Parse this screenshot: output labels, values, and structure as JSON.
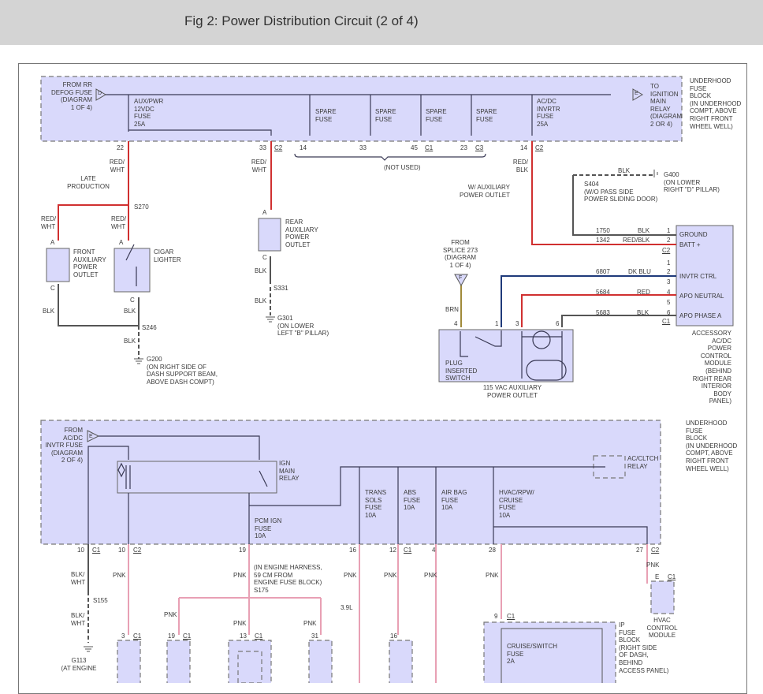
{
  "header": {
    "title": "Fig 2: Power Distribution Circuit (2 of 4)"
  },
  "colors": {
    "fuse_block_fill": "#d9d9fb",
    "wire_red": "#d03030",
    "wire_pink": "#e8a0b4",
    "wire_blue": "#1f3a7a",
    "wire_brown": "#a08a3a",
    "wire_black": "#555555"
  },
  "top_block": {
    "from_rr": "FROM RR\nDEFOG FUSE\n(DIAGRAM\n1 OF 4)",
    "conn_d": "D",
    "aux_fuse": "AUX/PWR\n12VDC\nFUSE\n25A",
    "spare_fuses": [
      "SPARE\nFUSE",
      "SPARE\nFUSE",
      "SPARE\nFUSE",
      "SPARE\nFUSE"
    ],
    "acdc_fuse": "AC/DC\nINVRTR\nFUSE\n25A",
    "conn_e": "E",
    "to_ign": "TO\nIGNITION\nMAIN\nRELAY\n(DIAGRAM\n2 OR 4)",
    "location": "UNDERHOOD\nFUSE\nBLOCK\n(IN UNDERHOOD\nCOMPT, ABOVE\nRIGHT FRONT\nWHEEL WELL)",
    "pins": [
      "22",
      "33",
      "C2",
      "14",
      "33",
      "45",
      "C1",
      "23",
      "C3",
      "14",
      "C2"
    ],
    "not_used": "(NOT USED)"
  },
  "left_circuit": {
    "wire1": "RED/\nWHT",
    "wire2": "RED/\nWHT",
    "late": "LATE\nPRODUCTION",
    "s270": "S270",
    "wire3": "RED/\nWHT",
    "wire4": "RED/\nWHT",
    "pin_a1": "A",
    "pin_a2": "A",
    "front_outlet": "FRONT\nAUXILIARY\nPOWER\nOUTLET",
    "cigar": "CIGAR\nLIGHTER",
    "pin_c1": "C",
    "pin_c2": "C",
    "blk1": "BLK",
    "blk2": "BLK",
    "s246": "S246",
    "blk3": "BLK",
    "g200": "G200\n(ON RIGHT SIDE OF\nDASH SUPPORT BEAM,\nABOVE DASH COMPT)"
  },
  "rear_outlet": {
    "wire": "RED/\nWHT",
    "pin_a": "A",
    "label": "REAR\nAUXILIARY\nPOWER\nOUTLET",
    "pin_c": "C",
    "blk1": "BLK",
    "s331": "S331",
    "blk2": "BLK",
    "g301": "G301\n(ON LOWER\nLEFT \"B\" PILLAR)"
  },
  "right_circuit": {
    "wire_redblk": "RED/\nBLK",
    "w_aux": "W/ AUXILIARY\nPOWER OUTLET",
    "blk": "BLK",
    "g400": "G400\n(ON LOWER\nRIGHT \"D\" PILLAR)",
    "s404": "S404\n(W/O PASS SIDE\nPOWER SLIDING DOOR)",
    "splice": "FROM\nSPLICE 273\n(DIAGRAM\n1 OF 4)",
    "conn_f": "F",
    "brn": "BRN",
    "outlet_pins": [
      "4",
      "1",
      "3",
      "6"
    ],
    "plug_switch": "PLUG\nINSERTED\nSWITCH",
    "outlet_label": "115 VAC AUXILIARY\nPOWER OUTLET",
    "wires": [
      {
        "circuit": "1750",
        "color": "BLK",
        "pin": "1"
      },
      {
        "circuit": "1342",
        "color": "RED/BLK",
        "pin": "2"
      },
      {
        "circuit": "6807",
        "color": "DK BLU",
        "pin": "2"
      },
      {
        "circuit": "5684",
        "color": "RED",
        "pin": "4"
      },
      {
        "circuit": "5683",
        "color": "BLK",
        "pin": "6"
      }
    ],
    "c2": "C2",
    "c1": "C1",
    "pin1": "1",
    "pin3": "3",
    "pin5": "5",
    "module_pins": [
      "GROUND",
      "BATT +",
      "INVTR CTRL",
      "APO NEUTRAL",
      "APO PHASE A"
    ],
    "module": "ACCESSORY\nAC/DC POWER\nCONTROL MODULE\n(BEHIND RIGHT REAR\nINTERIOR BODY PANEL)"
  },
  "bottom_block": {
    "from_acdc": "FROM\nAC/DC\nINVTR FUSE\n(DIAGRAM\n2 OF 4)",
    "conn_e": "E",
    "relay": "IGN\nMAIN\nRELAY",
    "pcm_fuse": "PCM IGN\nFUSE\n10A",
    "trans_fuse": "TRANS\nSOLS\nFUSE\n10A",
    "abs_fuse": "ABS\nFUSE\n10A",
    "airbag_fuse": "AIR BAG\nFUSE\n10A",
    "hvac_fuse": "HVAC/RPW/\nCRUISE\nFUSE\n10A",
    "ac_relay": "AC/CLTCH\nRELAY",
    "location": "UNDERHOOD\nFUSE\nBLOCK\n(IN UNDERHOOD\nCOMPT, ABOVE\nRIGHT FRONT\nWHEEL WELL)",
    "pins": [
      "10",
      "C1",
      "10",
      "C2",
      "19",
      "16",
      "12",
      "C1",
      "4",
      "28",
      "27",
      "C2"
    ]
  },
  "lower": {
    "blkwht1": "BLK/\nWHT",
    "s155": "S155",
    "blkwht2": "BLK/\nWHT",
    "g113": "G113\n(AT ENGINE",
    "pnk": [
      "PNK",
      "PNK",
      "PNK",
      "PNK",
      "PNK",
      "PNK",
      "PNK",
      "PNK",
      "PNK",
      "PNK"
    ],
    "harness": "(IN ENGINE HARNESS,\n59 CM FROM\nENGINE FUSE BLOCK)\nS175",
    "engine": "3.9L",
    "conn_pins": [
      "3",
      "C1",
      "19",
      "C1",
      "13",
      "C1",
      "31",
      "16"
    ],
    "hvac_pin": "E",
    "hvac_c1": "C1",
    "hvac_module": "HVAC\nCONTROL\nMODULE",
    "ip_pin": "9",
    "ip_c1": "C1",
    "cruise_fuse": "CRUISE/SWITCH\nFUSE\n2A",
    "ip_block": "IP\nFUSE\nBLOCK\n(RIGHT SIDE\nOF DASH,\nBEHIND\nACCESS PANEL)"
  }
}
